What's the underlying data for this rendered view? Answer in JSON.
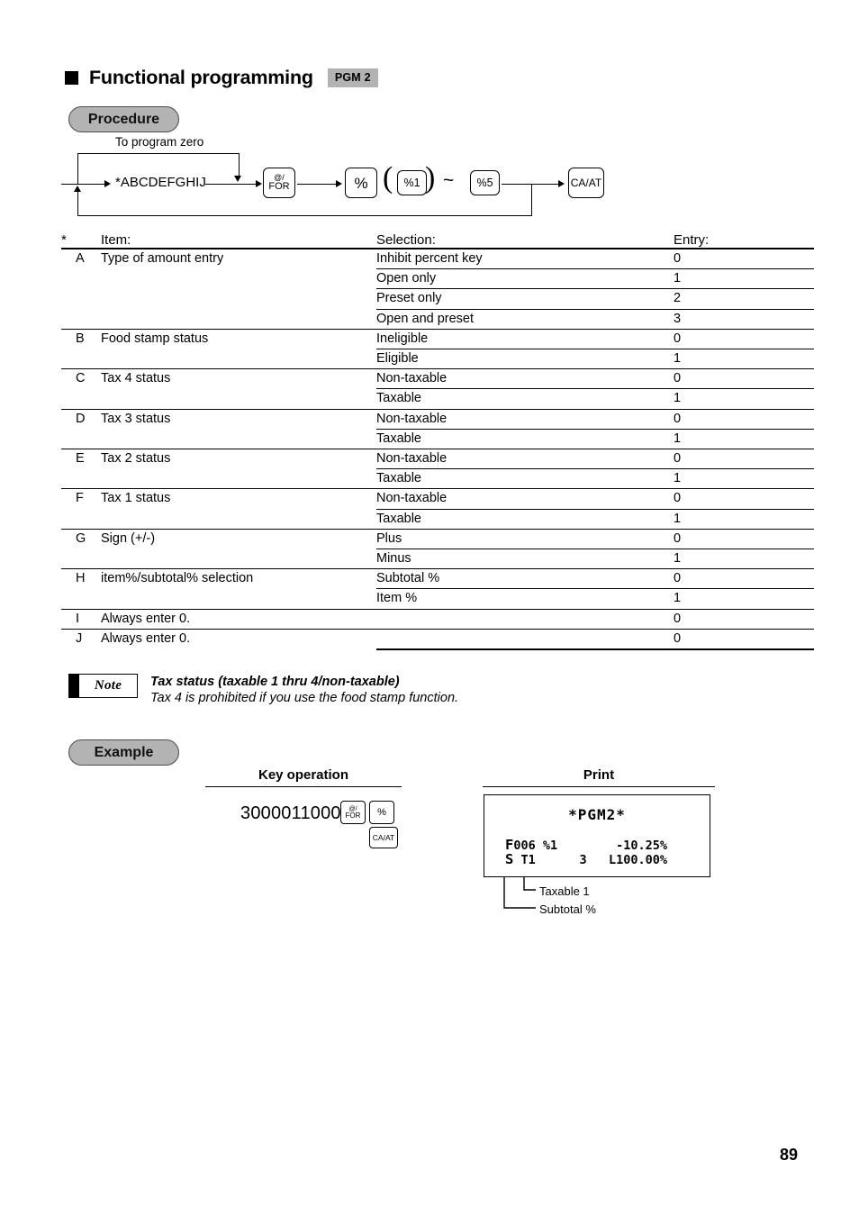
{
  "page": {
    "number": "89"
  },
  "header": {
    "title": "Functional programming",
    "mode_badge": "PGM 2"
  },
  "sections": {
    "procedure_label": "Procedure",
    "example_label": "Example"
  },
  "procedure": {
    "loop_label": "To program zero",
    "entry_sequence": "*ABCDEFGHIJ",
    "keys": {
      "for_line1": "@/",
      "for_line2": "FOR",
      "percent": "%",
      "percent1": "%1",
      "percent5": "%5",
      "cash_total": "CA/AT"
    },
    "paren_open": "(",
    "paren_close": ")",
    "range_mark": "~"
  },
  "table": {
    "star": "*",
    "headers": {
      "item": "Item:",
      "selection": "Selection:",
      "entry": "Entry:"
    },
    "rows": [
      {
        "code": "A",
        "item": "Type of amount entry",
        "options": [
          {
            "selection": "Inhibit percent key",
            "entry": "0"
          },
          {
            "selection": "Open only",
            "entry": "1"
          },
          {
            "selection": "Preset only",
            "entry": "2"
          },
          {
            "selection": "Open and preset",
            "entry": "3"
          }
        ]
      },
      {
        "code": "B",
        "item": "Food stamp status",
        "options": [
          {
            "selection": "Ineligible",
            "entry": "0"
          },
          {
            "selection": "Eligible",
            "entry": "1"
          }
        ]
      },
      {
        "code": "C",
        "item": "Tax 4 status",
        "options": [
          {
            "selection": "Non-taxable",
            "entry": "0"
          },
          {
            "selection": "Taxable",
            "entry": "1"
          }
        ]
      },
      {
        "code": "D",
        "item": "Tax 3 status",
        "options": [
          {
            "selection": "Non-taxable",
            "entry": "0"
          },
          {
            "selection": "Taxable",
            "entry": "1"
          }
        ]
      },
      {
        "code": "E",
        "item": "Tax 2 status",
        "options": [
          {
            "selection": "Non-taxable",
            "entry": "0"
          },
          {
            "selection": "Taxable",
            "entry": "1"
          }
        ]
      },
      {
        "code": "F",
        "item": "Tax 1 status",
        "options": [
          {
            "selection": "Non-taxable",
            "entry": "0"
          },
          {
            "selection": "Taxable",
            "entry": "1"
          }
        ]
      },
      {
        "code": "G",
        "item": "Sign (+/-)",
        "options": [
          {
            "selection": "Plus",
            "entry": "0"
          },
          {
            "selection": "Minus",
            "entry": "1"
          }
        ]
      },
      {
        "code": "H",
        "item": "item%/subtotal% selection",
        "options": [
          {
            "selection": "Subtotal %",
            "entry": "0"
          },
          {
            "selection": "Item %",
            "entry": "1"
          }
        ]
      },
      {
        "code": "I",
        "item": "Always enter 0.",
        "options": [
          {
            "selection": "",
            "entry": "0"
          }
        ]
      },
      {
        "code": "J",
        "item": "Always enter 0.",
        "options": [
          {
            "selection": "",
            "entry": "0"
          }
        ]
      }
    ]
  },
  "note": {
    "tag": "Note",
    "title": "Tax status (taxable 1 thru 4/non-taxable)",
    "body": "Tax 4 is prohibited if you use the food stamp function."
  },
  "example": {
    "key_operation_header": "Key operation",
    "print_header": "Print",
    "key_digits": "3000011000",
    "keys": {
      "for_line1": "@/",
      "for_line2": "FOR",
      "percent": "%",
      "cash_total": "CA/AT"
    },
    "receipt": {
      "title": "*PGM2*",
      "line1_lead": "F",
      "line1": "006 %1        -10.25%",
      "line2_lead": "S",
      "line2": " T1      3   L100.00%"
    },
    "callouts": {
      "taxable": "Taxable 1",
      "subtotal": "Subtotal %"
    }
  },
  "colors": {
    "badge_gray": "#b3b3b3",
    "ink": "#000000",
    "paper": "#ffffff"
  }
}
